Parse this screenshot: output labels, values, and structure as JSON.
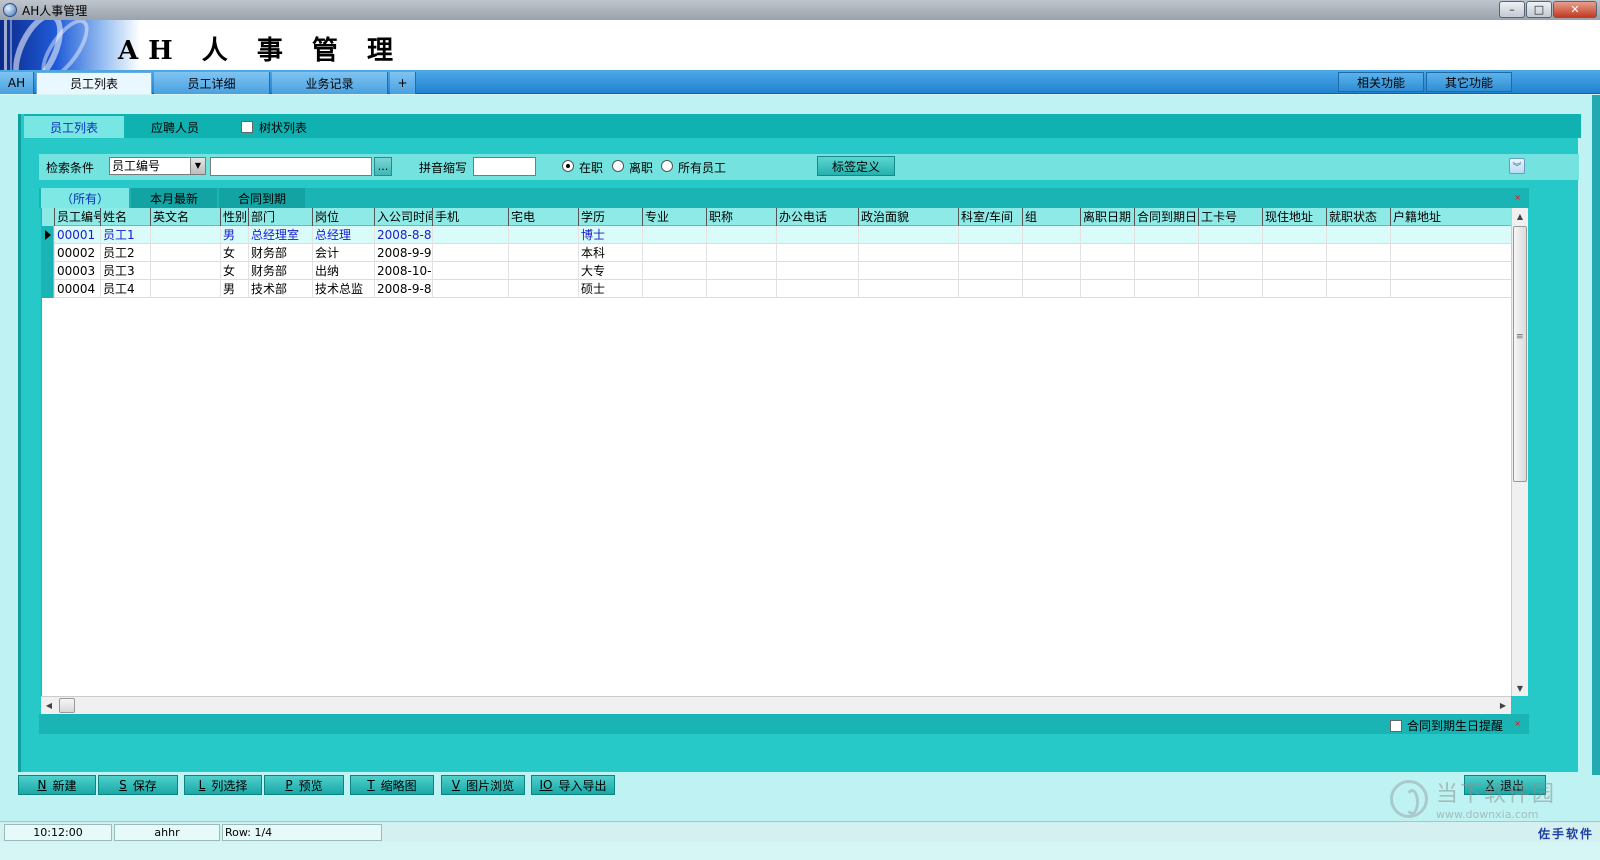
{
  "window": {
    "title": "AH人事管理",
    "min": "–",
    "max": "□",
    "close": "✕"
  },
  "banner": {
    "title": "AH 人 事 管 理"
  },
  "mainmenu": {
    "tabs": [
      "AH",
      "员工列表",
      "员工详细",
      "业务记录",
      "+"
    ],
    "right": [
      "相关功能",
      "其它功能"
    ]
  },
  "panel_tabs": {
    "tab1": "员工列表",
    "tab2": "应聘人员",
    "tab3": "树状列表"
  },
  "search": {
    "label": "检索条件",
    "field_value": "员工编号",
    "dropdown_arrow": "▼",
    "ellipsis": "...",
    "pinyin_label": "拼音缩写",
    "radios": [
      "在职",
      "离职",
      "所有员工"
    ],
    "tag_button": "标签定义",
    "collapse": "︾"
  },
  "grid_tabs": [
    "（所有）",
    "本月最新",
    "合同到期"
  ],
  "grid": {
    "columns": [
      "员工编号",
      "姓名",
      "英文名",
      "性别",
      "部门",
      "岗位",
      "入公司时间",
      "手机",
      "宅电",
      "学历",
      "专业",
      "职称",
      "办公电话",
      "政治面貌",
      "科室/车间",
      "组",
      "离职日期",
      "合同到期日",
      "工卡号",
      "现住地址",
      "就职状态",
      "户籍地址"
    ],
    "rows": [
      [
        "00001",
        "员工1",
        "",
        "男",
        "总经理室",
        "总经理",
        "2008-8-8",
        "",
        "",
        "博士",
        "",
        "",
        "",
        "",
        "",
        "",
        "",
        "",
        "",
        "",
        "",
        ""
      ],
      [
        "00002",
        "员工2",
        "",
        "女",
        "财务部",
        "会计",
        "2008-9-9",
        "",
        "",
        "本科",
        "",
        "",
        "",
        "",
        "",
        "",
        "",
        "",
        "",
        "",
        "",
        ""
      ],
      [
        "00003",
        "员工3",
        "",
        "女",
        "财务部",
        "出纳",
        "2008-10-",
        "",
        "",
        "大专",
        "",
        "",
        "",
        "",
        "",
        "",
        "",
        "",
        "",
        "",
        "",
        ""
      ],
      [
        "00004",
        "员工4",
        "",
        "男",
        "技术部",
        "技术总监",
        "2008-9-8",
        "",
        "",
        "硕士",
        "",
        "",
        "",
        "",
        "",
        "",
        "",
        "",
        "",
        "",
        "",
        ""
      ]
    ],
    "selected_row": 0
  },
  "scroll": {
    "up": "▲",
    "down": "▼",
    "left": "◀",
    "right": "▶",
    "grip": "≡"
  },
  "footer": {
    "remind_label": "合同到期生日提醒",
    "close_mark": "×"
  },
  "toolbar": {
    "buttons": [
      {
        "key": "N",
        "label": "新建"
      },
      {
        "key": "S",
        "label": "保存"
      },
      {
        "key": "L",
        "label": "列选择"
      },
      {
        "key": "P",
        "label": "预览"
      },
      {
        "key": "T",
        "label": "缩略图"
      },
      {
        "key": "V",
        "label": "图片浏览"
      },
      {
        "key": "IO",
        "label": "导入导出"
      }
    ],
    "exit": {
      "key": "X",
      "label": "退出"
    }
  },
  "statusbar": {
    "time": "10:12:00",
    "user": "ahhr",
    "row": "Row: 1/4",
    "brand": "佐手软件"
  },
  "watermark": {
    "cn": "当下软件园",
    "url": "www.downxia.com"
  },
  "colors": {
    "accent": "#27c8c8",
    "menu": "#2283cf",
    "selected_text": "#1b1bcc"
  }
}
